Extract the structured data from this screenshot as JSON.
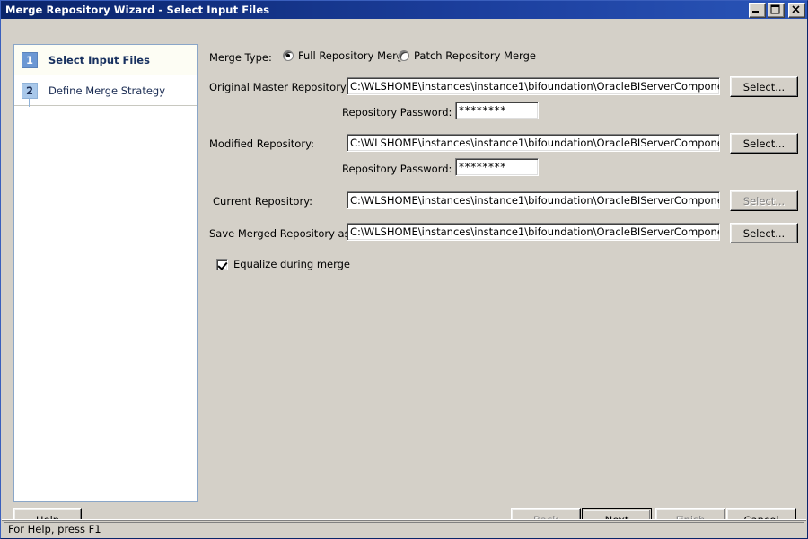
{
  "window": {
    "title": "Merge Repository Wizard - Select Input Files",
    "minimize_icon": "minimize-icon",
    "maximize_icon": "maximize-icon",
    "close_icon": "close-icon"
  },
  "sidebar": {
    "steps": [
      {
        "number": "1",
        "label": "Select Input Files",
        "active": true
      },
      {
        "number": "2",
        "label": "Define Merge Strategy",
        "active": false
      }
    ]
  },
  "form": {
    "merge_type_label": "Merge Type:",
    "merge_type_options": [
      {
        "label": "Full Repository Merge",
        "selected": true
      },
      {
        "label": "Patch Repository Merge",
        "selected": false
      }
    ],
    "original_master": {
      "label": "Original Master Repository:",
      "path": "C:\\WLSHOME\\instances\\instance1\\bifoundation\\OracleBIServerComponent\\coreappl",
      "select_label": "Select...",
      "password_label": "Repository Password:",
      "password_value": "********"
    },
    "modified": {
      "label": "Modified Repository:",
      "path": "C:\\WLSHOME\\instances\\instance1\\bifoundation\\OracleBIServerComponent\\coreappl",
      "select_label": "Select...",
      "password_label": "Repository Password:",
      "password_value": "********"
    },
    "current": {
      "label": "Current Repository:",
      "path": "C:\\WLSHOME\\instances\\instance1\\bifoundation\\OracleBIServerComponent\\coreappl",
      "select_label": "Select..."
    },
    "save_merged": {
      "label": "Save Merged Repository as:",
      "path": "C:\\WLSHOME\\instances\\instance1\\bifoundation\\OracleBIServerComponent\\coreappl",
      "select_label": "Select..."
    },
    "equalize_label": "Equalize during merge",
    "equalize_checked": true
  },
  "footer": {
    "help_label": "Help",
    "back_label": "Back",
    "next_label": "Next",
    "finish_label": "Finish",
    "cancel_label": "Cancel"
  },
  "statusbar": {
    "text": "For Help, press F1"
  }
}
